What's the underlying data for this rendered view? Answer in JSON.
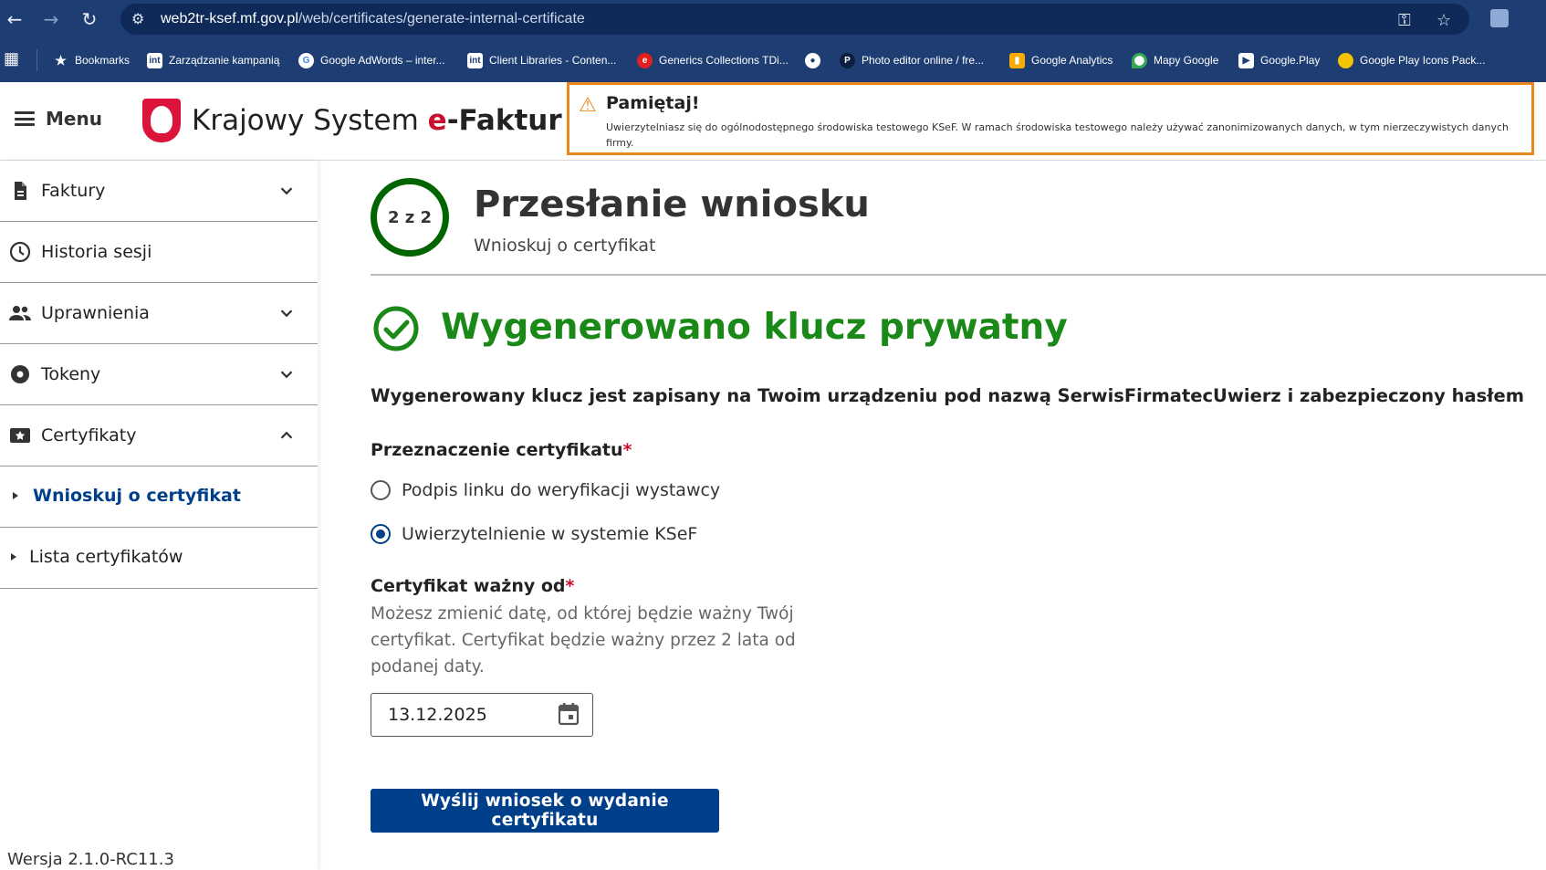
{
  "browser": {
    "url_host": "web2tr-ksef.mf.gov.pl",
    "url_path": "/web/certificates/generate-internal-certificate",
    "bookmarks": [
      {
        "label": "Bookmarks",
        "icon": "star-icon"
      },
      {
        "label": "Zarządzanie kampanią",
        "icon": "int-icon"
      },
      {
        "label": "Google AdWords – inter...",
        "icon": "google-icon"
      },
      {
        "label": "Client Libraries - Conten...",
        "icon": "int-icon"
      },
      {
        "label": "Generics Collections TDi...",
        "icon": "e-icon"
      },
      {
        "label": "",
        "icon": "globe-icon"
      },
      {
        "label": "Photo editor online / fre...",
        "icon": "photo-icon"
      },
      {
        "label": "Google Analytics",
        "icon": "analytics-icon"
      },
      {
        "label": "Mapy Google",
        "icon": "maps-icon"
      },
      {
        "label": "Google.Play",
        "icon": "play-icon"
      },
      {
        "label": "Google Play Icons Pack...",
        "icon": "circle-icon"
      }
    ]
  },
  "header": {
    "menu_label": "Menu",
    "logo_prefix": "Krajowy System ",
    "logo_e": "e",
    "logo_suffix": "-Faktur",
    "alert_title": "Pamiętaj!",
    "alert_text": "Uwierzytelniasz się do ogólnodostępnego środowiska testowego KSeF. W ramach środowiska testowego należy używać zanonimizowanych danych, w tym nierzeczywistych danych firmy."
  },
  "sidebar": {
    "items": [
      {
        "label": "Faktury",
        "icon": "document-icon",
        "chevron": "down"
      },
      {
        "label": "Historia sesji",
        "icon": "clock-icon",
        "chevron": ""
      },
      {
        "label": "Uprawnienia",
        "icon": "people-icon",
        "chevron": "down"
      },
      {
        "label": "Tokeny",
        "icon": "token-icon",
        "chevron": "down"
      },
      {
        "label": "Certyfikaty",
        "icon": "certificate-icon",
        "chevron": "up"
      }
    ],
    "subitems": [
      {
        "label": "Wnioskuj o certyfikat",
        "active": true
      },
      {
        "label": "Lista certyfikatów",
        "active": false
      }
    ],
    "version": "Wersja 2.1.0-RC11.3"
  },
  "main": {
    "step": "2 z 2",
    "title": "Przesłanie wniosku",
    "subtitle": "Wnioskuj o certyfikat",
    "success_title": "Wygenerowano klucz prywatny",
    "description": "Wygenerowany klucz jest zapisany na Twoim urządzeniu pod nazwą SerwisFirmatecUwierz i zabezpieczony hasłem",
    "purpose_label": "Przeznaczenie certyfikatu",
    "required_mark": "*",
    "radio_options": [
      {
        "label": "Podpis linku do weryfikacji wystawcy",
        "selected": false
      },
      {
        "label": "Uwierzytelnienie w systemie KSeF",
        "selected": true
      }
    ],
    "valid_from_label": "Certyfikat ważny od",
    "valid_from_hint": "Możesz zmienić datę, od której będzie ważny Twój certyfikat. Certyfikat będzie ważny przez 2 lata od podanej daty.",
    "valid_from_value": "13.12.2025",
    "submit_label": "Wyślij wniosek o wydanie certyfikatu"
  },
  "colors": {
    "browser_bar": "#1e3d72",
    "primary": "#003f8a",
    "success": "#1a8917",
    "step_ring": "#006400",
    "alert_border": "#e8891f",
    "required": "#c8102e"
  }
}
